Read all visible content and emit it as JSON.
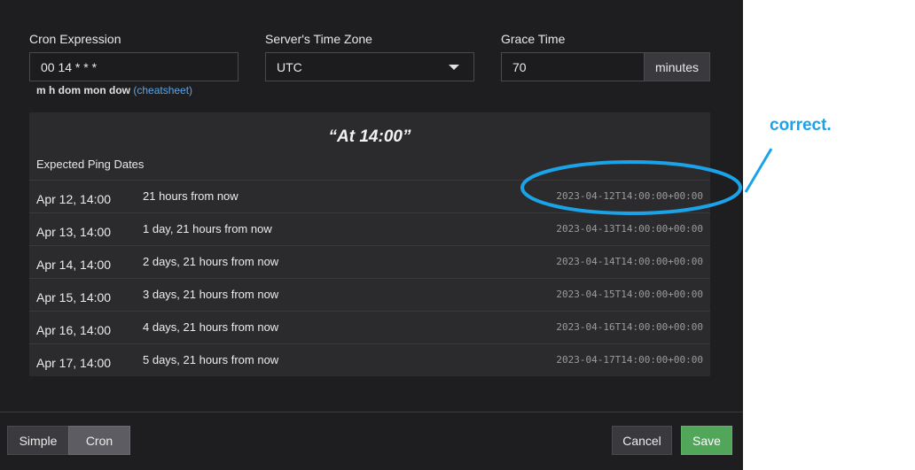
{
  "form": {
    "cron_label": "Cron Expression",
    "cron_value": "00 14 * * *",
    "cron_help": "m h dom mon dow",
    "cheatsheet_link": "(cheatsheet)",
    "tz_label": "Server's Time Zone",
    "tz_value": "UTC",
    "grace_label": "Grace Time",
    "grace_value": "70",
    "grace_unit": "minutes"
  },
  "preview": {
    "human": "“At 14:00”",
    "expected_label": "Expected Ping Dates",
    "rows": [
      {
        "date": "Apr 12, 14:00",
        "relative": "21 hours from now",
        "iso": "2023-04-12T14:00:00+00:00"
      },
      {
        "date": "Apr 13, 14:00",
        "relative": "1 day, 21 hours from now",
        "iso": "2023-04-13T14:00:00+00:00"
      },
      {
        "date": "Apr 14, 14:00",
        "relative": "2 days, 21 hours from now",
        "iso": "2023-04-14T14:00:00+00:00"
      },
      {
        "date": "Apr 15, 14:00",
        "relative": "3 days, 21 hours from now",
        "iso": "2023-04-15T14:00:00+00:00"
      },
      {
        "date": "Apr 16, 14:00",
        "relative": "4 days, 21 hours from now",
        "iso": "2023-04-16T14:00:00+00:00"
      },
      {
        "date": "Apr 17, 14:00",
        "relative": "5 days, 21 hours from now",
        "iso": "2023-04-17T14:00:00+00:00"
      }
    ]
  },
  "footer": {
    "simple_label": "Simple",
    "cron_label": "Cron",
    "cancel_label": "Cancel",
    "save_label": "Save"
  },
  "annotation": {
    "text": "correct.",
    "color": "#1aa3e8"
  },
  "colors": {
    "modal_bg": "#1e1e20",
    "link": "#5aa6e8",
    "save": "#52a659"
  }
}
